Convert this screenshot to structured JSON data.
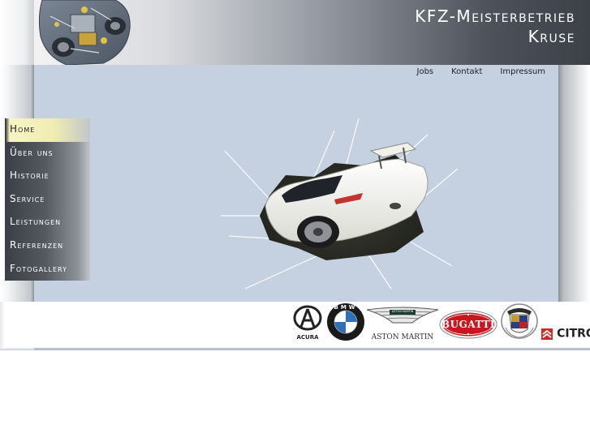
{
  "header": {
    "brand_line1": "KFZ-Meisterbetrieb",
    "brand_line2": "Kruse"
  },
  "top_links": [
    "Jobs",
    "Kontakt",
    "Impressum"
  ],
  "menu": {
    "items": [
      {
        "label": "Home",
        "active": true
      },
      {
        "label": "Über uns",
        "active": false
      },
      {
        "label": "Historie",
        "active": false
      },
      {
        "label": "Service",
        "active": false
      },
      {
        "label": "Leistungen",
        "active": false
      },
      {
        "label": "Referenzen",
        "active": false
      },
      {
        "label": "Fotogallery",
        "active": false
      }
    ]
  },
  "logos": {
    "acura": "ACURA",
    "bmw": "BMW",
    "aston_martin": "ASTON MARTIN",
    "aston_martin_badge": "ASTON MARTIN",
    "bugatti": "BUGATTI",
    "citroen": "CITRO"
  },
  "colors": {
    "content_bg": "#c5d0e0",
    "menu_active_bg": "#f7f5c6",
    "header_dark": "#3c4047"
  }
}
